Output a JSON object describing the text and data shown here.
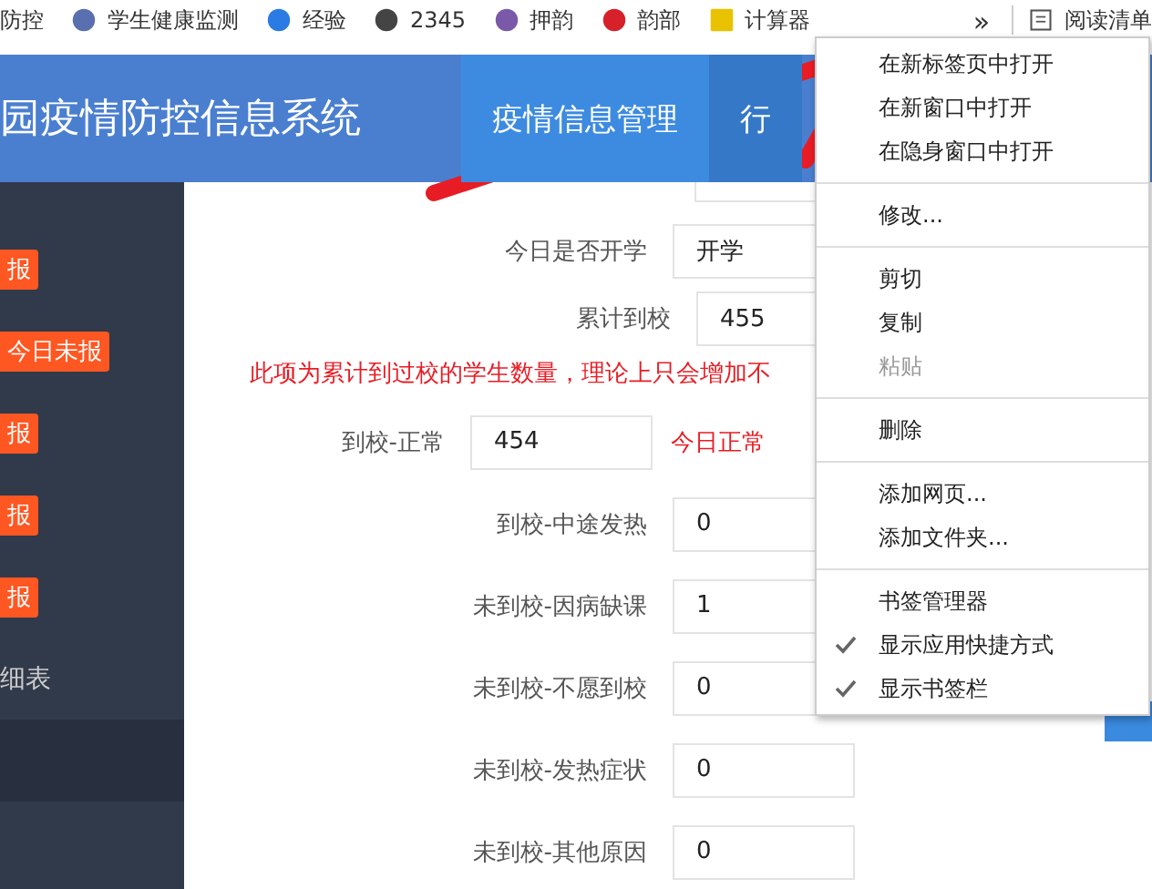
{
  "bookmarks": [
    {
      "label": "防控"
    },
    {
      "label": "学生健康监测"
    },
    {
      "label": "经验"
    },
    {
      "label": "2345"
    },
    {
      "label": "押韵"
    },
    {
      "label": "韵部"
    },
    {
      "label": "计算器"
    }
  ],
  "bookmarks_more": "»",
  "reading_list": "阅读清单",
  "header": {
    "title": "园疫情防控信息系统",
    "nav": [
      {
        "label": "疫情信息管理",
        "selected": true
      },
      {
        "label": "行",
        "selected": false
      }
    ]
  },
  "sidebar": {
    "items": [
      {
        "kind": "badge",
        "label": "报"
      },
      {
        "kind": "badge",
        "label": "今日未报"
      },
      {
        "kind": "badge",
        "label": "报"
      },
      {
        "kind": "badge",
        "label": "报"
      },
      {
        "kind": "badge",
        "label": "报"
      },
      {
        "kind": "text",
        "label": "细表"
      },
      {
        "kind": "active"
      }
    ]
  },
  "form": [
    {
      "kind": "select",
      "label": "今日是否开学",
      "value": "开学"
    },
    {
      "kind": "shifted",
      "label": "累计到校",
      "value": "455"
    },
    {
      "kind": "note",
      "label": "此项为累计到过校的学生数量，理论上只会增加不"
    },
    {
      "kind": "hinted",
      "label": "到校-正常",
      "value": "454",
      "hint": "今日正常"
    },
    {
      "kind": "field",
      "label": "到校-中途发热",
      "value": "0"
    },
    {
      "kind": "field",
      "label": "未到校-因病缺课",
      "value": "1"
    },
    {
      "kind": "field",
      "label": "未到校-不愿到校",
      "value": "0"
    },
    {
      "kind": "field",
      "label": "未到校-发热症状",
      "value": "0"
    },
    {
      "kind": "field",
      "label": "未到校-其他原因",
      "value": "0"
    }
  ],
  "context_menu": [
    {
      "kind": "item",
      "label": "在新标签页中打开",
      "disabled": false,
      "checked": false
    },
    {
      "kind": "item",
      "label": "在新窗口中打开",
      "disabled": false,
      "checked": false
    },
    {
      "kind": "item",
      "label": "在隐身窗口中打开",
      "disabled": false,
      "checked": false
    },
    {
      "kind": "separator"
    },
    {
      "kind": "item",
      "label": "修改...",
      "disabled": false,
      "checked": false
    },
    {
      "kind": "separator"
    },
    {
      "kind": "item",
      "label": "剪切",
      "disabled": false,
      "checked": false
    },
    {
      "kind": "item",
      "label": "复制",
      "disabled": false,
      "checked": false
    },
    {
      "kind": "item",
      "label": "粘贴",
      "disabled": true,
      "checked": false
    },
    {
      "kind": "separator"
    },
    {
      "kind": "item",
      "label": "删除",
      "disabled": false,
      "checked": false
    },
    {
      "kind": "separator"
    },
    {
      "kind": "item",
      "label": "添加网页...",
      "disabled": false,
      "checked": false
    },
    {
      "kind": "item",
      "label": "添加文件夹...",
      "disabled": false,
      "checked": false
    },
    {
      "kind": "separator"
    },
    {
      "kind": "item",
      "label": "书签管理器",
      "disabled": false,
      "checked": false
    },
    {
      "kind": "item",
      "label": "显示应用快捷方式",
      "disabled": false,
      "checked": true
    },
    {
      "kind": "item",
      "label": "显示书签栏",
      "disabled": false,
      "checked": true
    }
  ]
}
